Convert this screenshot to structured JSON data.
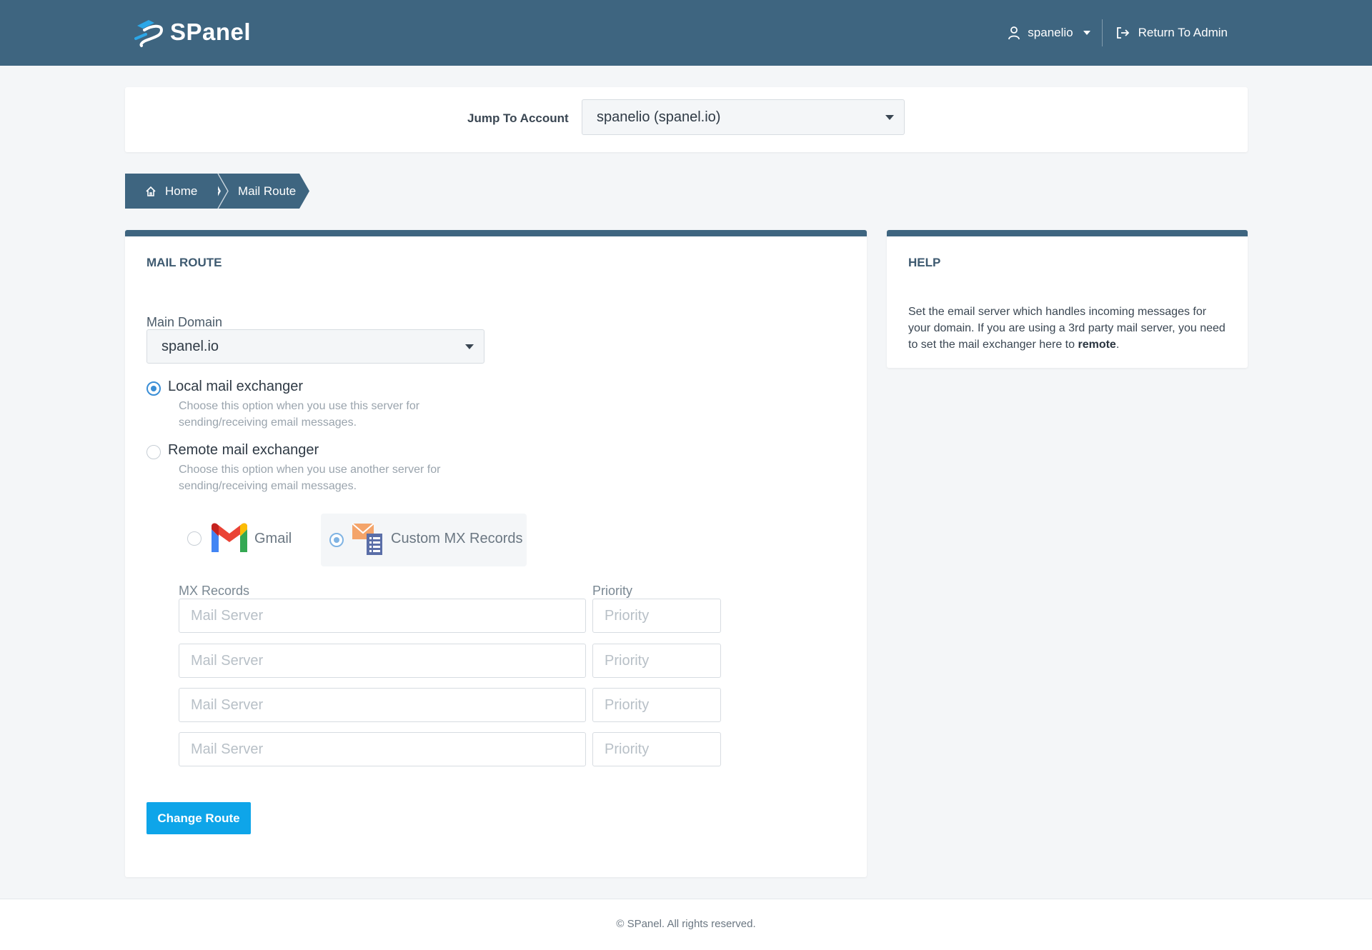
{
  "header": {
    "logo_text": "SPanel",
    "username": "spanelio",
    "return_label": "Return To Admin"
  },
  "jump": {
    "label": "Jump To Account",
    "selected": "spanelio (spanel.io)"
  },
  "breadcrumb": {
    "home": "Home",
    "current": "Mail Route"
  },
  "mail_route": {
    "title": "MAIL ROUTE",
    "main_domain_label": "Main Domain",
    "main_domain_value": "spanel.io",
    "local": {
      "title": "Local mail exchanger",
      "desc": "Choose this option when you use this server for sending/receiving email messages.",
      "checked": true
    },
    "remote": {
      "title": "Remote mail exchanger",
      "desc": "Choose this option when you use another server for sending/receiving email messages.",
      "checked": false
    },
    "providers": {
      "gmail": "Gmail",
      "custom": "Custom MX Records"
    },
    "mx_label": "MX Records",
    "priority_label": "Priority",
    "rows": [
      {
        "server_placeholder": "Mail Server",
        "priority_placeholder": "Priority"
      },
      {
        "server_placeholder": "Mail Server",
        "priority_placeholder": "Priority"
      },
      {
        "server_placeholder": "Mail Server",
        "priority_placeholder": "Priority"
      },
      {
        "server_placeholder": "Mail Server",
        "priority_placeholder": "Priority"
      }
    ],
    "submit_label": "Change Route"
  },
  "help": {
    "title": "HELP",
    "text_before": "Set the email server which handles incoming messages for your domain. If you are using a 3rd party mail server, you need to set the mail exchanger here to ",
    "text_bold": "remote",
    "text_after": "."
  },
  "footer": {
    "text": "© SPanel. All rights reserved."
  },
  "colors": {
    "header_bg": "#3e6580",
    "primary_button": "#0ea5e9",
    "radio_accent": "#3a8ed6"
  }
}
